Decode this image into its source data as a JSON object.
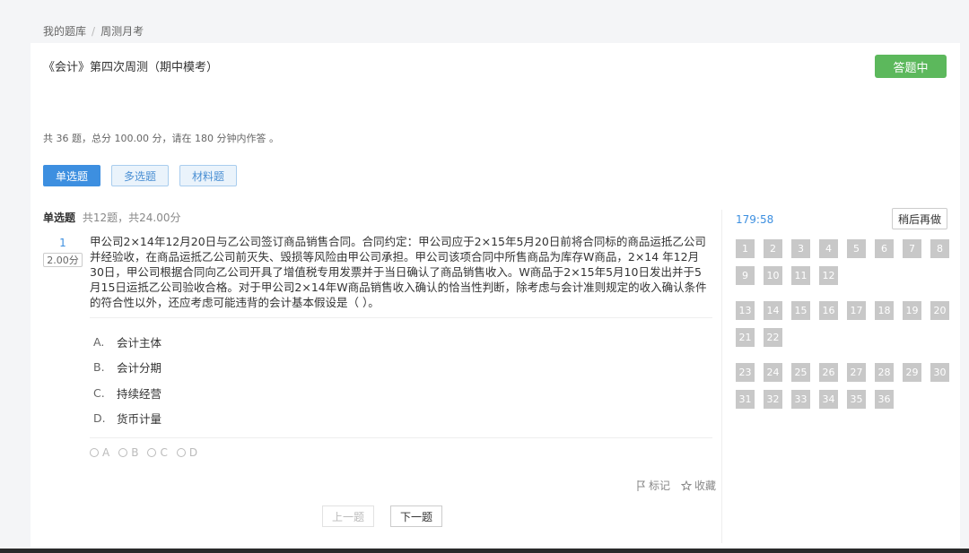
{
  "breadcrumb": {
    "items": [
      "我的题库",
      "周测月考"
    ],
    "separator": "/"
  },
  "exam": {
    "title": "《会计》第四次周测（期中模考）",
    "status_label": "答题中",
    "info": "共 36 题，总分 100.00 分，请在 180 分钟内作答 。"
  },
  "type_tabs": [
    {
      "label": "单选题",
      "active": true
    },
    {
      "label": "多选题",
      "active": false
    },
    {
      "label": "材料题",
      "active": false
    }
  ],
  "section": {
    "name": "单选题",
    "meta": "共12题，共24.00分"
  },
  "question": {
    "number": "1",
    "score": "2.00分",
    "text": "甲公司2×14年12月20日与乙公司签订商品销售合同。合同约定：甲公司应于2×15年5月20日前将合同标的商品运抵乙公司并经验收，在商品运抵乙公司前灭失、毁损等风险由甲公司承担。甲公司该项合同中所售商品为库存W商品，2×14 年12月30日，甲公司根据合同向乙公司开具了增值税专用发票并于当日确认了商品销售收入。W商品于2×15年5月10日发出并于5月15日运抵乙公司验收合格。对于甲公司2×14年W商品销售收入确认的恰当性判断，除考虑与会计准则规定的收入确认条件的符合性以外，还应考虑可能违背的会计基本假设是（ ）。",
    "options": [
      {
        "key": "A.",
        "text": "会计主体"
      },
      {
        "key": "B.",
        "text": "会计分期"
      },
      {
        "key": "C.",
        "text": "持续经营"
      },
      {
        "key": "D.",
        "text": "货币计量"
      }
    ],
    "answer_choices": [
      "A",
      "B",
      "C",
      "D"
    ]
  },
  "actions": {
    "mark_label": "标记",
    "favorite_label": "收藏"
  },
  "navigation": {
    "prev_label": "上一题",
    "next_label": "下一题"
  },
  "panel": {
    "timer": "179:58",
    "later_label": "稍后再做",
    "sections": [
      [
        "1",
        "2",
        "3",
        "4",
        "5",
        "6",
        "7",
        "8",
        "9",
        "10",
        "11",
        "12"
      ],
      [
        "13",
        "14",
        "15",
        "16",
        "17",
        "18",
        "19",
        "20",
        "21",
        "22"
      ],
      [
        "23",
        "24",
        "25",
        "26",
        "27",
        "28",
        "29",
        "30",
        "31",
        "32",
        "33",
        "34",
        "35",
        "36"
      ]
    ]
  },
  "icons": {
    "mark": "flag-icon",
    "favorite": "star-icon"
  },
  "colors": {
    "accent": "#3d8fe0",
    "status": "#5cb85c",
    "cell": "#c8c8c8"
  }
}
